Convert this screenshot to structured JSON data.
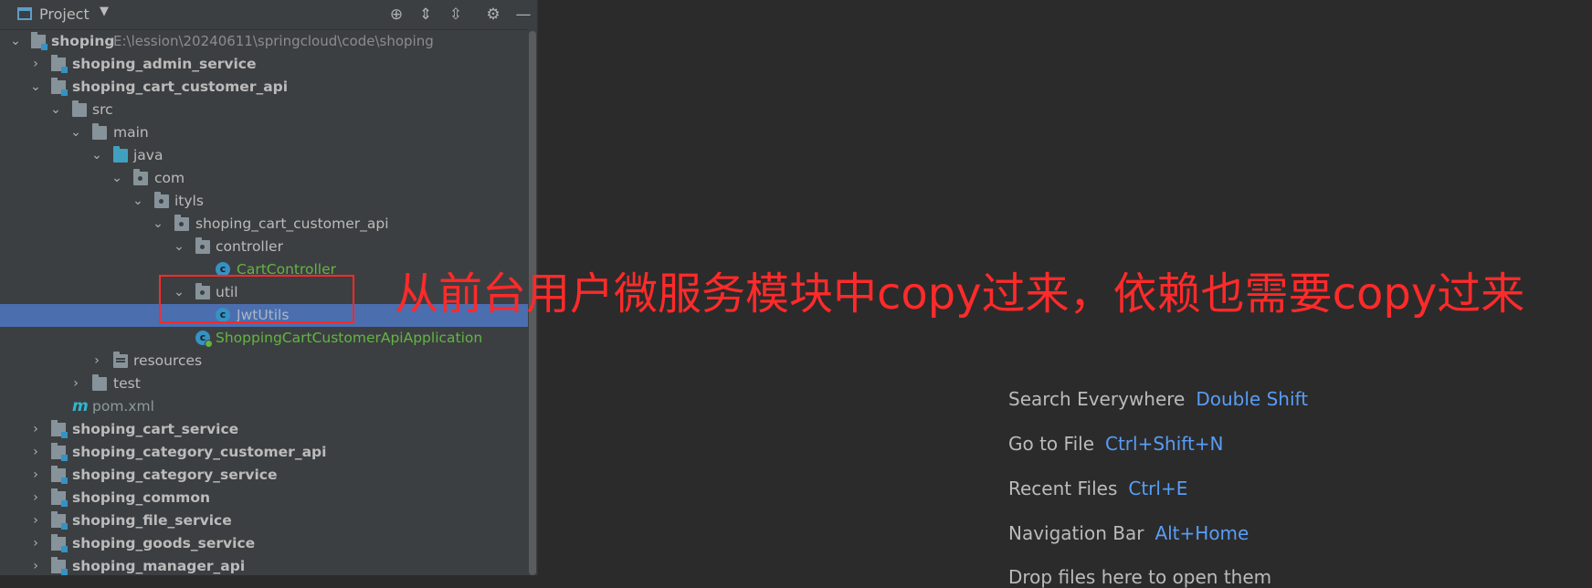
{
  "toolbar": {
    "title": "Project",
    "icons": [
      "project-window-icon",
      "dropdown-icon",
      "locate-icon",
      "expand-all-icon",
      "collapse-all-icon",
      "gear-icon",
      "minimize-icon"
    ]
  },
  "tree": {
    "root": {
      "name": "shoping",
      "path": "E:\\lession\\20240611\\springcloud\\code\\shoping"
    },
    "items": [
      {
        "label": "shoping_admin_service"
      },
      {
        "label": "shoping_cart_customer_api"
      },
      {
        "label": "src"
      },
      {
        "label": "main"
      },
      {
        "label": "java"
      },
      {
        "label": "com"
      },
      {
        "label": "ityls"
      },
      {
        "label": "shoping_cart_customer_api"
      },
      {
        "label": "controller"
      },
      {
        "label": "CartController"
      },
      {
        "label": "util"
      },
      {
        "label": "JwtUtils"
      },
      {
        "label": "ShoppingCartCustomerApiApplication"
      },
      {
        "label": "resources"
      },
      {
        "label": "test"
      },
      {
        "label": "pom.xml"
      },
      {
        "label": "shoping_cart_service"
      },
      {
        "label": "shoping_category_customer_api"
      },
      {
        "label": "shoping_category_service"
      },
      {
        "label": "shoping_common"
      },
      {
        "label": "shoping_file_service"
      },
      {
        "label": "shoping_goods_service"
      },
      {
        "label": "shoping_manager_api"
      }
    ],
    "selected": "JwtUtils"
  },
  "annotation": {
    "text": "从前台用户微服务模块中copy过来，依赖也需要copy过来",
    "color": "#ff2a2a"
  },
  "editor_hints": [
    {
      "label": "Search Everywhere",
      "shortcut": "Double Shift"
    },
    {
      "label": "Go to File",
      "shortcut": "Ctrl+Shift+N"
    },
    {
      "label": "Recent Files",
      "shortcut": "Ctrl+E"
    },
    {
      "label": "Navigation Bar",
      "shortcut": "Alt+Home"
    },
    {
      "label": "Drop files here to open them",
      "shortcut": ""
    }
  ],
  "colors": {
    "panel_bg": "#3c3f41",
    "editor_bg": "#2b2b2b",
    "selection": "#4b6eaf",
    "link": "#589df6"
  }
}
